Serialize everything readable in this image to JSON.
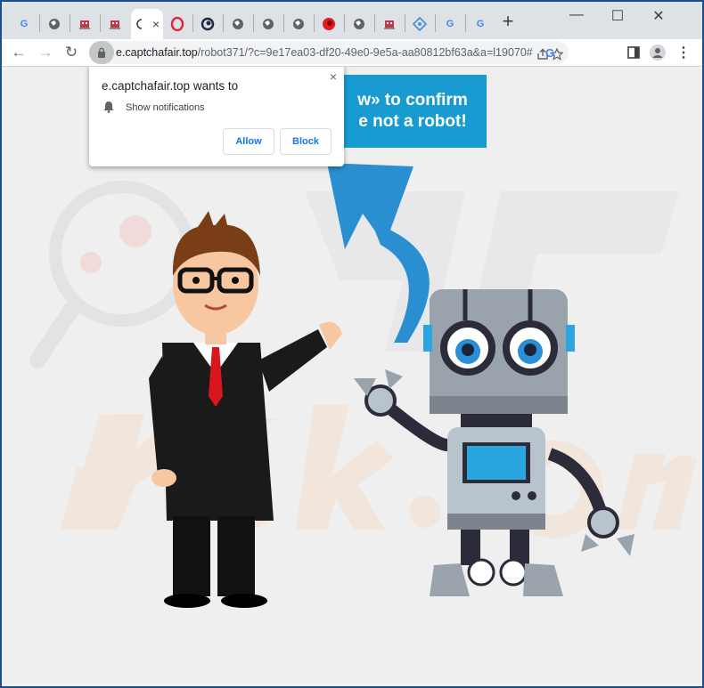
{
  "browser": {
    "tabs": [
      {
        "icon": "google-g-icon",
        "label": "G",
        "color": "#4285f4"
      },
      {
        "icon": "globe-icon",
        "label": ""
      },
      {
        "icon": "robot-icon",
        "label": ""
      },
      {
        "icon": "robot-icon",
        "label": ""
      },
      {
        "icon": "loading-icon",
        "label": "",
        "active": true
      },
      {
        "icon": "opera-icon",
        "label": ""
      },
      {
        "icon": "swirl-icon",
        "label": ""
      },
      {
        "icon": "globe-icon",
        "label": ""
      },
      {
        "icon": "globe-icon",
        "label": ""
      },
      {
        "icon": "globe-icon",
        "label": ""
      },
      {
        "icon": "red-circle-icon",
        "label": ""
      },
      {
        "icon": "globe-icon",
        "label": ""
      },
      {
        "icon": "robot-icon",
        "label": ""
      },
      {
        "icon": "puzzle-icon",
        "label": ""
      },
      {
        "icon": "google-g-icon",
        "label": "G"
      },
      {
        "icon": "google-g-icon",
        "label": "G"
      }
    ],
    "active_tab_close": "×",
    "new_tab": "+",
    "window_controls": {
      "minimize": "—",
      "maximize": "☐",
      "close": "✕"
    },
    "nav": {
      "back": "←",
      "forward": "→",
      "reload": "↻"
    },
    "url_host": "e.captchafair.top",
    "url_rest": "/robot371/?c=9e17ea03-df20-49e0-9e5a-aa80812bf63a&a=l19070#",
    "menu": "⋮",
    "accent": "#1a73e8"
  },
  "page": {
    "banner_line1": "w» to confirm",
    "banner_line2": "e not a robot!",
    "banner_color": "#189bd0"
  },
  "notification_prompt": {
    "title": "e.captchafair.top wants to",
    "close": "×",
    "permission": "Show notifications",
    "allow": "Allow",
    "block": "Block"
  }
}
